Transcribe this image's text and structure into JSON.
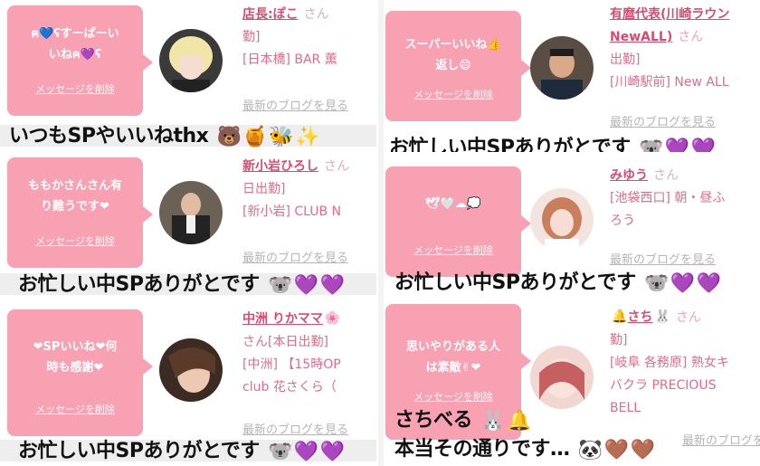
{
  "common": {
    "delete_label": "メッセージを削除",
    "blog_label": "最新のブログを見る",
    "san": "さん"
  },
  "colors": {
    "bubble": "#f8a1b3",
    "name": "#dd4a6f",
    "text": "#e56b87",
    "muted": "#b5b5b5"
  },
  "cards": [
    {
      "bubble_lines": [
        "ฅ💙ʕすーぱーい",
        "いねฅ💜ʕ"
      ],
      "name": "店長:ぽこ",
      "lines": [
        "勤]",
        "[日本橋] BAR 薫"
      ],
      "blog": "最新のブログを見る",
      "caption": "いつもSPやいいねthx",
      "caption_emojis": [
        "bear-icon",
        "honey-icon",
        "bee-icon",
        "sparkle-icon"
      ]
    },
    {
      "bubble_lines": [
        "スーパーいいね👍",
        "返し😄"
      ],
      "name": "有麿代表(川崎ラウン",
      "name2": "NewALL)",
      "lines": [
        "出勤]",
        "[川崎駅前] New ALL"
      ],
      "blog": "最新のブログを見る",
      "caption": "お忙しい中SPありがとです",
      "caption_emojis": [
        "koala-icon",
        "purple-heart-icon",
        "purple-heart-icon"
      ]
    },
    {
      "bubble_lines": [
        "ももかさんさん有",
        "り難うです❤"
      ],
      "name": "新小岩ひろし",
      "lines": [
        "日出勤]",
        "[新小岩] CLUB N"
      ],
      "blog": "最新のブログを見る",
      "caption": "お忙しい中SPありがとです",
      "caption_emojis": [
        "koala-icon",
        "purple-heart-icon",
        "purple-heart-icon"
      ]
    },
    {
      "bubble_lines": [
        "🕊🤍☁💭"
      ],
      "name": "みゆう",
      "lines": [
        "[池袋西口] 朝・昼ふ",
        "ろう"
      ],
      "blog": "最新のブログを見る",
      "caption": "お忙しい中SPありがとです",
      "caption_emojis": [
        "koala-icon",
        "purple-heart-icon",
        "purple-heart-icon"
      ]
    },
    {
      "bubble_lines": [
        "❤SPいいね❤何",
        "時も感謝❤"
      ],
      "name": "中洲 りかママ",
      "lines": [
        "さん[本日出勤]",
        "[中洲] 【15時OP",
        "club 花さくら（"
      ],
      "blog": "最新のブログを見る",
      "caption": "お忙しい中SPありがとです",
      "caption_emojis": [
        "koala-icon",
        "purple-heart-icon",
        "purple-heart-icon"
      ]
    },
    {
      "bubble_lines": [
        "思いやりがある人",
        "は素敵✌❤"
      ],
      "name": "さち",
      "lines": [
        "勤]",
        "[岐阜 各務原] 熟女キ",
        "バクラ PRECIOUS",
        "BELL"
      ],
      "blog": "最新のブログを見る",
      "caption": "さちべる",
      "caption2": "本当その通りです…",
      "caption_emojis": [
        "rabbit-icon",
        "bell-icon"
      ],
      "caption2_emojis": [
        "panda-icon",
        "brown-heart-icon",
        "brown-heart-icon"
      ]
    }
  ]
}
